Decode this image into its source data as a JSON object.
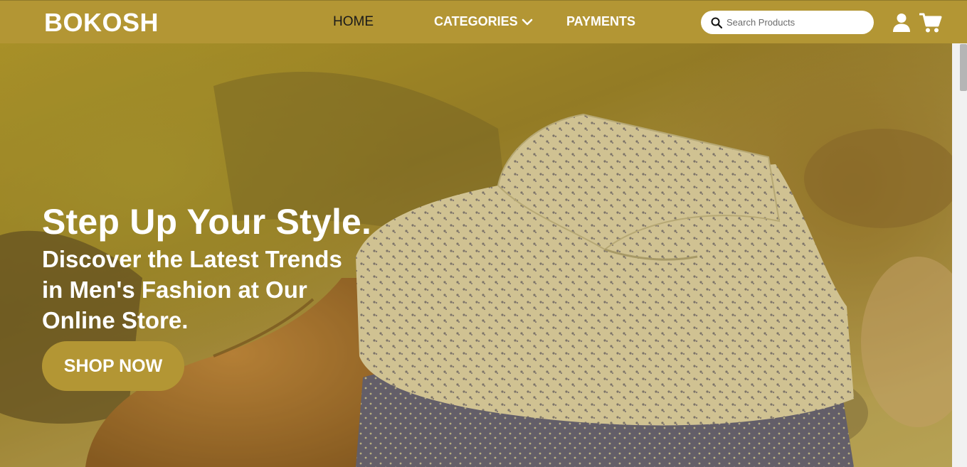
{
  "brand": {
    "name": "BOKOSH",
    "color": "#b39634"
  },
  "nav": {
    "home": "HOME",
    "categories": "CATEGORIES",
    "payments": "PAYMENTS"
  },
  "search": {
    "placeholder": "Search Products",
    "value": ""
  },
  "icons": {
    "search": "search-icon",
    "categories_dropdown": "chevron-down-icon",
    "account": "user-icon",
    "cart": "cart-icon"
  },
  "hero": {
    "headline": "Step Up Your Style.",
    "subhead": "Discover the Latest Trends in Men's Fashion at Our Online Store.",
    "cta_label": "SHOP NOW"
  }
}
